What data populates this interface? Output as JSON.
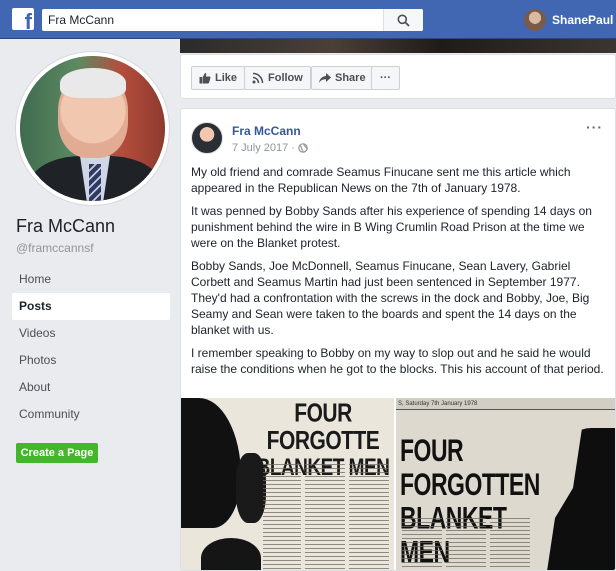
{
  "topbar": {
    "logo": "f",
    "search_value": "Fra McCann",
    "user_name": "ShanePaul"
  },
  "profile": {
    "name": "Fra McCann",
    "handle": "@framccannsf"
  },
  "nav": {
    "items": [
      {
        "label": "Home",
        "active": false
      },
      {
        "label": "Posts",
        "active": true
      },
      {
        "label": "Videos",
        "active": false
      },
      {
        "label": "Photos",
        "active": false
      },
      {
        "label": "About",
        "active": false
      },
      {
        "label": "Community",
        "active": false
      }
    ],
    "create_page": "Create a Page"
  },
  "actions": {
    "like": "Like",
    "follow": "Follow",
    "share": "Share",
    "more": "···"
  },
  "post": {
    "author": "Fra McCann",
    "date": "7 July 2017",
    "more": "···",
    "paragraphs": [
      "My old friend and comrade Seamus Finucane sent me this article which appeared in the Republican News on the 7th of January 1978.",
      "It was penned by Bobby Sands after his experience of spending 14 days on punishment behind the wire in B Wing Crumlin Road Prison at the time we were on the Blanket protest.",
      "Bobby Sands, Joe McDonnell, Seamus Finucane, Sean Lavery, Gabriel Corbett and Seamus Martin had just been sentenced in September 1977. They'd had a confrontation with the screws in the dock and Bobby, Joe, Big Seamy and Sean were taken to the boards and spent the 14 days on the blanket with us.",
      "I remember speaking to Bobby on my way to slop out and he said he would raise the conditions when he got to the blocks. This his account of that period."
    ],
    "images": {
      "left_headline_1": "FOUR FORGOTTE",
      "left_headline_2": "BLANKET MEN",
      "right_dateline": "S, Saturday 7th January 1978",
      "right_headline": "FOUR FORGOTTEN BLANKET MEN"
    }
  },
  "colors": {
    "brand_blue": "#4267b2",
    "link_blue": "#365899",
    "green_button": "#42b72a",
    "page_bg": "#e9ebee"
  },
  "icons": [
    "facebook-logo",
    "search-icon",
    "like-icon",
    "follow-icon",
    "share-icon",
    "globe-icon",
    "more-icon"
  ]
}
